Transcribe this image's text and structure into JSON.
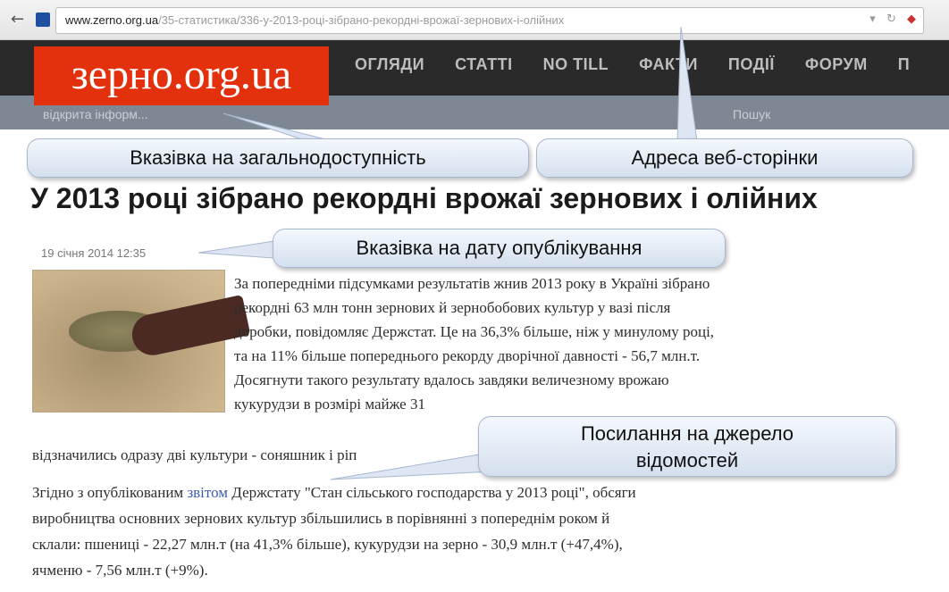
{
  "browser": {
    "back_icon": "back-arrow-icon",
    "url_domain": "www.zerno.org.ua",
    "url_path": "/35-статистика/336-у-2013-році-зібрано-рекордні-врожаї-зернових-і-олійних"
  },
  "site": {
    "logo": "зерно.org.ua",
    "nav": [
      "ОГЛЯДИ",
      "СТАТТІ",
      "NO TILL",
      "ФАКТИ",
      "ПОДІЇ",
      "ФОРУМ",
      "П"
    ],
    "subbar_text": "відкрита інформ...",
    "subbar_text2": "Пошук"
  },
  "callouts": {
    "public_access": "Вказівка на загальнодоступність",
    "web_address": "Адреса веб-сторінки",
    "pub_date": "Вказівка на дату опублікування",
    "source_link_1": "Посилання на джерело",
    "source_link_2": "відомостей"
  },
  "article": {
    "headline": "У 2013 році зібрано рекордні врожаї зернових і олійних",
    "date": "19 січня 2014  12:35",
    "p1_lines": [
      "За попередніми підсумками результатів жнив 2013 року в Україні зібрано",
      "рекордні 63 млн тонн зернових й зернобобових культур у вазі після",
      "доробки, повідомляє Держстат. Це на 36,3% більше, ніж у минулому році,",
      "та на 11% більше попереднього рекорду дворічної давності - 56,7 млн.т.",
      "Досягнути такого результату вдалось завдяки величезному врожаю",
      "кукурудзи в розмірі майже 31"
    ],
    "p2": "відзначились одразу дві культури - соняшник і ріп",
    "p3_line1_pre": "Згідно з опублікованим ",
    "p3_link": "звітом",
    "p3_line1_post": " Держстату \"Стан сільського господарства у 2013 році\", обсяги",
    "p3_line2": "виробництва основних зернових культур збільшились в порівнянні з попереднім роком й",
    "p3_line3": "склали: пшениці - 22,27 млн.т (на 41,3% більше), кукурудзи на зерно - 30,9 млн.т (+47,4%),",
    "p3_line4": "ячменю - 7,56 млн.т (+9%)."
  }
}
